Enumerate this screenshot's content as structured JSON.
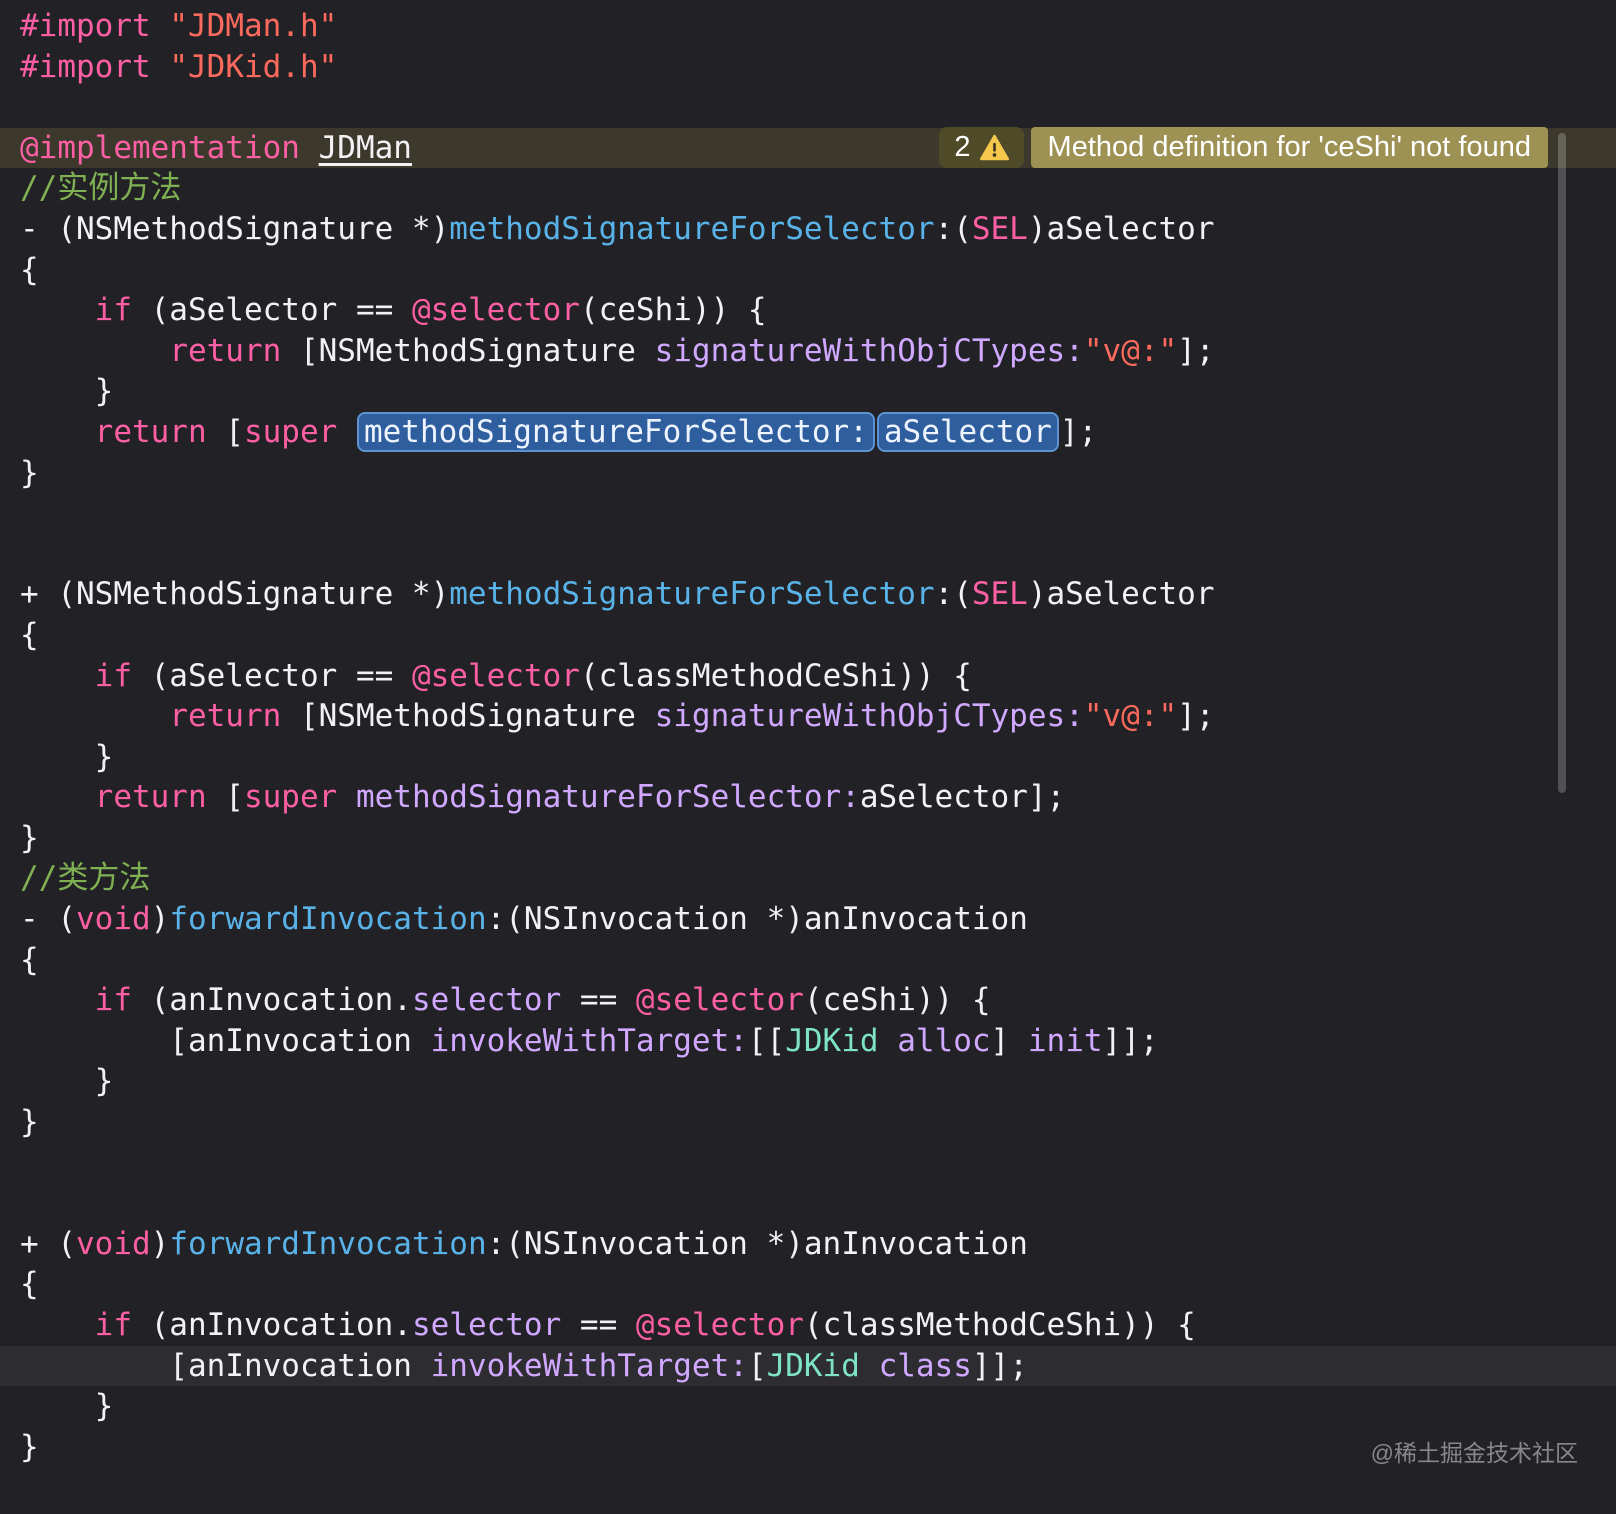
{
  "colors": {
    "editor_bg": "#212126",
    "plain": "#f2f2f4",
    "keyword": "#fc5fa3",
    "string": "#fc6a5d",
    "comment": "#7fb152",
    "declaration": "#5ab3e8",
    "method": "#d0a8ff",
    "project_type": "#7de3c3",
    "selection_bg": "#2f5e9e",
    "selection_border": "#5d92d2",
    "warning_badge_bg": "#4f4a28",
    "warning_message_bg": "#9d9254",
    "warning_icon": "#f5c84c",
    "warning_row_tint": "rgba(214,186,80,0.15)",
    "current_line_bg": "rgba(255,255,255,0.05)",
    "scrollbar_thumb": "rgba(255,255,255,0.22)",
    "watermark_color": "rgba(235,235,240,0.5)"
  },
  "warning_banner": {
    "count": "2",
    "icon": "warning-triangle-icon",
    "message": "Method definition for 'ceShi' not found"
  },
  "watermark": "@稀土掘金技术社区",
  "editor": {
    "language": "objective-c",
    "lines": [
      {
        "seg": [
          [
            "k",
            "#import"
          ],
          [
            "p",
            " "
          ],
          [
            "s",
            "\"JDMan.h\""
          ]
        ]
      },
      {
        "seg": [
          [
            "k",
            "#import"
          ],
          [
            "p",
            " "
          ],
          [
            "s",
            "\"JDKid.h\""
          ]
        ]
      },
      {
        "seg": []
      },
      {
        "warning": true,
        "seg": [
          [
            "k",
            "@implementation"
          ],
          [
            "p",
            " "
          ],
          [
            "u",
            "JDMan"
          ]
        ]
      },
      {
        "seg": [
          [
            "c",
            "//实例方法"
          ]
        ]
      },
      {
        "seg": [
          [
            "p",
            "- (NSMethodSignature *)"
          ],
          [
            "d",
            "methodSignatureForSelector"
          ],
          [
            "p",
            ":("
          ],
          [
            "k",
            "SEL"
          ],
          [
            "p",
            ")aSelector"
          ]
        ]
      },
      {
        "seg": [
          [
            "p",
            "{"
          ]
        ]
      },
      {
        "seg": [
          [
            "p",
            "    "
          ],
          [
            "k",
            "if"
          ],
          [
            "p",
            " (aSelector == "
          ],
          [
            "k",
            "@selector"
          ],
          [
            "p",
            "(ceShi)) {"
          ]
        ]
      },
      {
        "seg": [
          [
            "p",
            "        "
          ],
          [
            "k",
            "return"
          ],
          [
            "p",
            " [NSMethodSignature "
          ],
          [
            "m",
            "signatureWithObjCTypes:"
          ],
          [
            "s",
            "\"v@:\""
          ],
          [
            "p",
            "];"
          ]
        ]
      },
      {
        "seg": [
          [
            "p",
            "    }"
          ]
        ]
      },
      {
        "seg": [
          [
            "p",
            "    "
          ],
          [
            "k",
            "return"
          ],
          [
            "p",
            " ["
          ],
          [
            "k",
            "super"
          ],
          [
            "p",
            " "
          ],
          [
            "sel1",
            "methodSignatureForSelector:"
          ],
          [
            "sel2",
            "aSelector"
          ],
          [
            "p",
            "];"
          ]
        ]
      },
      {
        "seg": [
          [
            "p",
            "}"
          ]
        ]
      },
      {
        "seg": []
      },
      {
        "seg": []
      },
      {
        "seg": [
          [
            "p",
            "+ (NSMethodSignature *)"
          ],
          [
            "d",
            "methodSignatureForSelector"
          ],
          [
            "p",
            ":("
          ],
          [
            "k",
            "SEL"
          ],
          [
            "p",
            ")aSelector"
          ]
        ]
      },
      {
        "seg": [
          [
            "p",
            "{"
          ]
        ]
      },
      {
        "seg": [
          [
            "p",
            "    "
          ],
          [
            "k",
            "if"
          ],
          [
            "p",
            " (aSelector == "
          ],
          [
            "k",
            "@selector"
          ],
          [
            "p",
            "(classMethodCeShi)) {"
          ]
        ]
      },
      {
        "seg": [
          [
            "p",
            "        "
          ],
          [
            "k",
            "return"
          ],
          [
            "p",
            " [NSMethodSignature "
          ],
          [
            "m",
            "signatureWithObjCTypes:"
          ],
          [
            "s",
            "\"v@:\""
          ],
          [
            "p",
            "];"
          ]
        ]
      },
      {
        "seg": [
          [
            "p",
            "    }"
          ]
        ]
      },
      {
        "seg": [
          [
            "p",
            "    "
          ],
          [
            "k",
            "return"
          ],
          [
            "p",
            " ["
          ],
          [
            "k",
            "super"
          ],
          [
            "p",
            " "
          ],
          [
            "m",
            "methodSignatureForSelector:"
          ],
          [
            "p",
            "aSelector];"
          ]
        ]
      },
      {
        "seg": [
          [
            "p",
            "}"
          ]
        ]
      },
      {
        "seg": [
          [
            "c",
            "//类方法"
          ]
        ]
      },
      {
        "seg": [
          [
            "p",
            "- ("
          ],
          [
            "k",
            "void"
          ],
          [
            "p",
            ")"
          ],
          [
            "d",
            "forwardInvocation"
          ],
          [
            "p",
            ":(NSInvocation *)anInvocation"
          ]
        ]
      },
      {
        "seg": [
          [
            "p",
            "{"
          ]
        ]
      },
      {
        "seg": [
          [
            "p",
            "    "
          ],
          [
            "k",
            "if"
          ],
          [
            "p",
            " (anInvocation."
          ],
          [
            "m",
            "selector"
          ],
          [
            "p",
            " == "
          ],
          [
            "k",
            "@selector"
          ],
          [
            "p",
            "(ceShi)) {"
          ]
        ]
      },
      {
        "seg": [
          [
            "p",
            "        [anInvocation "
          ],
          [
            "m",
            "invokeWithTarget:"
          ],
          [
            "p",
            "[["
          ],
          [
            "t",
            "JDKid"
          ],
          [
            "p",
            " "
          ],
          [
            "m",
            "alloc"
          ],
          [
            "p",
            "] "
          ],
          [
            "m",
            "init"
          ],
          [
            "p",
            "]];"
          ]
        ]
      },
      {
        "seg": [
          [
            "p",
            "    }"
          ]
        ]
      },
      {
        "seg": [
          [
            "p",
            "}"
          ]
        ]
      },
      {
        "seg": []
      },
      {
        "seg": []
      },
      {
        "seg": [
          [
            "p",
            "+ ("
          ],
          [
            "k",
            "void"
          ],
          [
            "p",
            ")"
          ],
          [
            "d",
            "forwardInvocation"
          ],
          [
            "p",
            ":(NSInvocation *)anInvocation"
          ]
        ]
      },
      {
        "seg": [
          [
            "p",
            "{"
          ]
        ]
      },
      {
        "seg": [
          [
            "p",
            "    "
          ],
          [
            "k",
            "if"
          ],
          [
            "p",
            " (anInvocation."
          ],
          [
            "m",
            "selector"
          ],
          [
            "p",
            " == "
          ],
          [
            "k",
            "@selector"
          ],
          [
            "p",
            "(classMethodCeShi)) {"
          ]
        ]
      },
      {
        "highlight": true,
        "seg": [
          [
            "p",
            "        [anInvocation "
          ],
          [
            "m",
            "invokeWithTarget:"
          ],
          [
            "p",
            "["
          ],
          [
            "t",
            "JDKid"
          ],
          [
            "p",
            " "
          ],
          [
            "m",
            "class"
          ],
          [
            "p",
            "]];"
          ]
        ]
      },
      {
        "seg": [
          [
            "p",
            "    }"
          ]
        ]
      },
      {
        "seg": [
          [
            "p",
            "}"
          ]
        ]
      }
    ]
  }
}
